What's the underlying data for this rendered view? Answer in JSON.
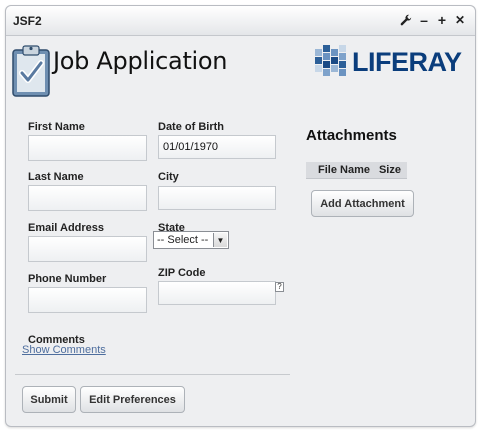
{
  "portlet": {
    "title": "JSF2",
    "icons": [
      "wrench-icon",
      "minimize-icon",
      "maximize-icon",
      "close-icon"
    ],
    "minimize_glyph": "–",
    "maximize_glyph": "+",
    "close_glyph": "✕"
  },
  "header": {
    "heading": "Job Application",
    "logo_text": "LIFERAY"
  },
  "form": {
    "first_name": {
      "label": "First Name",
      "value": ""
    },
    "date_of_birth": {
      "label": "Date of Birth",
      "value": "01/01/1970"
    },
    "last_name": {
      "label": "Last Name",
      "value": ""
    },
    "city": {
      "label": "City",
      "value": ""
    },
    "email": {
      "label": "Email Address",
      "value": ""
    },
    "state": {
      "label": "State",
      "selected": "-- Select --"
    },
    "phone": {
      "label": "Phone Number",
      "value": ""
    },
    "zip": {
      "label": "ZIP Code",
      "value": "",
      "help": "?"
    },
    "comments": {
      "label": "Comments",
      "link": "Show Comments"
    }
  },
  "attachments": {
    "title": "Attachments",
    "columns": [
      "File Name",
      "Size"
    ],
    "add_button": "Add Attachment"
  },
  "footer": {
    "submit_label": "Submit",
    "preferences_label": "Edit Preferences"
  },
  "colors": {
    "logo_blue": "#0a3d7c",
    "link_blue": "#4e6e9e",
    "panel_bg": "#eeeff1"
  }
}
